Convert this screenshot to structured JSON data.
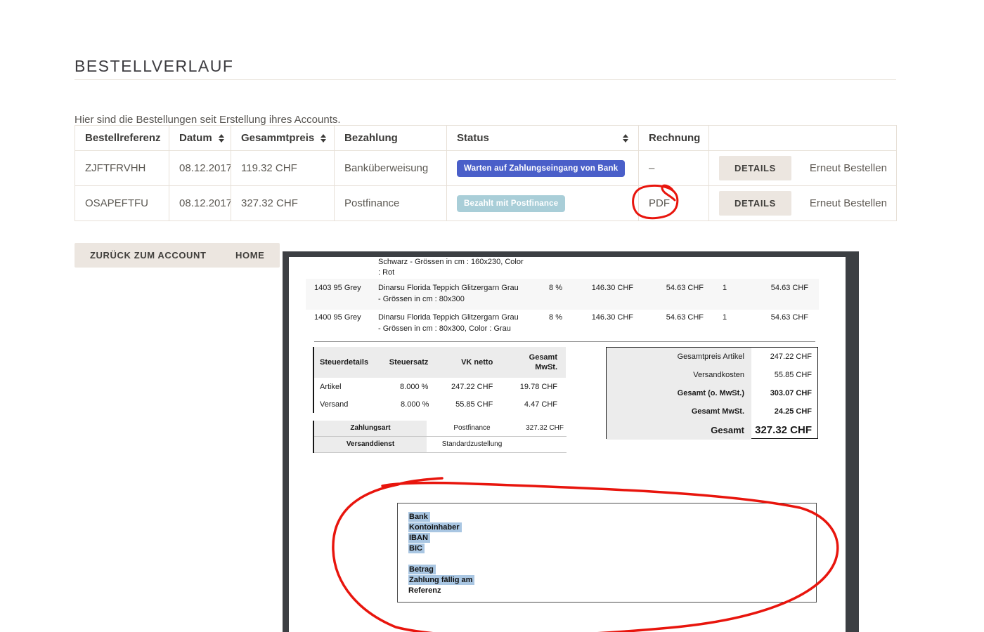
{
  "page": {
    "title": "BESTELLVERLAUF",
    "subtitle": "Hier sind die Bestellungen seit Erstellung ihres Accounts."
  },
  "orders": {
    "headers": {
      "reference": "Bestellreferenz",
      "date": "Datum",
      "total": "Gesammtpreis",
      "payment": "Bezahlung",
      "status": "Status",
      "invoice": "Rechnung"
    },
    "rows": [
      {
        "reference": "ZJFTFRVHH",
        "date": "08.12.2017",
        "total": "119.32 CHF",
        "payment": "Banküberweisung",
        "status": "Warten auf Zahlungseingang von Bank",
        "invoice": "–",
        "details": "DETAILS",
        "reorder": "Erneut Bestellen"
      },
      {
        "reference": "OSAPEFTFU",
        "date": "08.12.2017",
        "total": "327.32 CHF",
        "payment": "Postfinance",
        "status": "Bezahlt mit Postfinance",
        "invoice": "PDF",
        "details": "DETAILS",
        "reorder": "Erneut Bestellen"
      }
    ]
  },
  "actions": {
    "back": "ZURÜCK ZUM ACCOUNT",
    "home": "HOME"
  },
  "pdf": {
    "carryover": {
      "line1": "Schwarz - Grössen in cm : 160x230, Color",
      "line2": ": Rot"
    },
    "products": [
      {
        "ref": "1403 95 Grey",
        "name": "Dinarsu Florida Teppich Glitzergarn Grau",
        "variant": "- Grössen in cm : 80x300",
        "tax": "8 %",
        "unit": "146.30 CHF",
        "price": "54.63 CHF",
        "qty": "1",
        "total": "54.63 CHF"
      },
      {
        "ref": "1400 95 Grey",
        "name": "Dinarsu Florida Teppich Glitzergarn Grau",
        "variant": "- Grössen in cm : 80x300, Color : Grau",
        "tax": "8 %",
        "unit": "146.30 CHF",
        "price": "54.63 CHF",
        "qty": "1",
        "total": "54.63 CHF"
      }
    ],
    "tax_table": {
      "headers": [
        "Steuerdetails",
        "Steuersatz",
        "VK netto",
        "Gesamt MwSt."
      ],
      "rows": [
        [
          "Artikel",
          "8.000 %",
          "247.22 CHF",
          "19.78 CHF"
        ],
        [
          "Versand",
          "8.000 %",
          "55.85 CHF",
          "4.47 CHF"
        ]
      ]
    },
    "totals": [
      {
        "label": "Gesamtpreis Artikel",
        "value": "247.22 CHF"
      },
      {
        "label": "Versandkosten",
        "value": "55.85 CHF"
      },
      {
        "label": "Gesamt (o. MwSt.)",
        "value": "303.07 CHF"
      },
      {
        "label": "Gesamt MwSt.",
        "value": "24.25 CHF"
      },
      {
        "label": "Gesamt",
        "value": "327.32 CHF"
      }
    ],
    "payment": {
      "method_label": "Zahlungsart",
      "method": "Postfinance",
      "amount": "327.32 CHF",
      "carrier_label": "Versanddienst",
      "carrier": "Standardzustellung"
    },
    "bank": {
      "fields_group1": [
        "Bank",
        "Kontoinhaber",
        "IBAN",
        "BIC"
      ],
      "fields_group2": [
        "Betrag",
        "Zahlung fällig am",
        "Referenz"
      ]
    }
  },
  "colors": {
    "badge_pending": "#4a5fc9",
    "badge_paid": "#a9ced8",
    "highlight": "#a9c6e2",
    "annotation": "#e8150d",
    "button_bg": "#ece6e0"
  }
}
